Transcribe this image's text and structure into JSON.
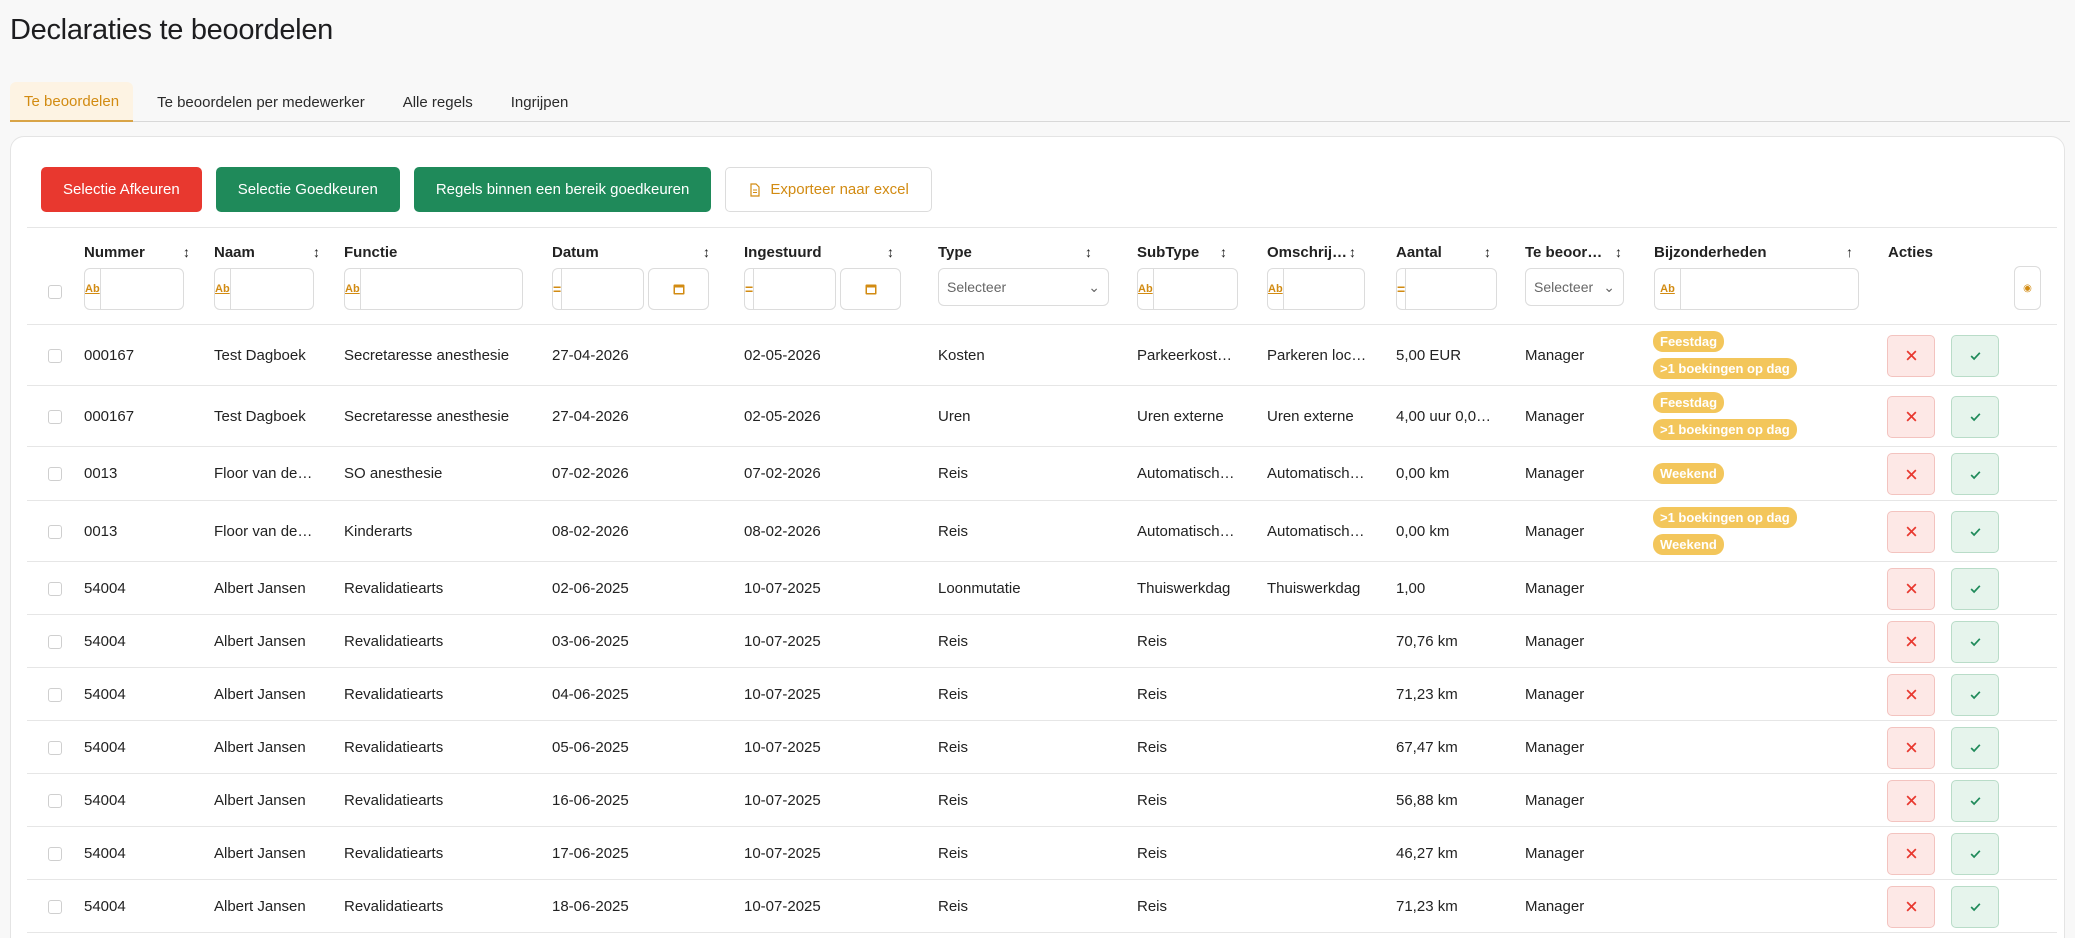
{
  "page": {
    "title": "Declaraties te beoordelen"
  },
  "tabs": [
    "Te beoordelen",
    "Te beoordelen per medewerker",
    "Alle regels",
    "Ingrijpen"
  ],
  "toolbar": {
    "reject_label": "Selectie Afkeuren",
    "approve_label": "Selectie Goedkeuren",
    "range_label": "Regels binnen een bereik goedkeuren",
    "export_label": "Exporteer naar excel"
  },
  "columns": {
    "nummer": "Nummer",
    "naam": "Naam",
    "functie": "Functie",
    "datum": "Datum",
    "ingestuurd": "Ingestuurd",
    "type": "Type",
    "subtype": "SubType",
    "omschrijving": "Omschrij…",
    "aantal": "Aantal",
    "te_beoordelen": "Te beoor…",
    "bijzonderheden": "Bijzonderheden",
    "acties": "Acties"
  },
  "filters": {
    "text_badge": "Ab",
    "eq_badge": "=",
    "select_placeholder": "Selecteer"
  },
  "rows": [
    {
      "nummer": "000167",
      "naam": "Test Dagboek",
      "functie": "Secretaresse anesthesie",
      "datum": "27-04-2026",
      "ingestuurd": "02-05-2026",
      "type": "Kosten",
      "subtype": "Parkeerkost…",
      "omschrijving": "Parkeren loc…",
      "aantal": "5,00 EUR",
      "te_beoordelen": "Manager",
      "bijzonderheden": [
        "Feestdag",
        ">1 boekingen op dag"
      ]
    },
    {
      "nummer": "000167",
      "naam": "Test Dagboek",
      "functie": "Secretaresse anesthesie",
      "datum": "27-04-2026",
      "ingestuurd": "02-05-2026",
      "type": "Uren",
      "subtype": "Uren externe",
      "omschrijving": "Uren externe",
      "aantal": "4,00 uur 0,0…",
      "te_beoordelen": "Manager",
      "bijzonderheden": [
        "Feestdag",
        ">1 boekingen op dag"
      ]
    },
    {
      "nummer": "0013",
      "naam": "Floor van de…",
      "functie": "SO anesthesie",
      "datum": "07-02-2026",
      "ingestuurd": "07-02-2026",
      "type": "Reis",
      "subtype": "Automatisch…",
      "omschrijving": "Automatisch…",
      "aantal": "0,00 km",
      "te_beoordelen": "Manager",
      "bijzonderheden": [
        "Weekend"
      ]
    },
    {
      "nummer": "0013",
      "naam": "Floor van de…",
      "functie": "Kinderarts",
      "datum": "08-02-2026",
      "ingestuurd": "08-02-2026",
      "type": "Reis",
      "subtype": "Automatisch…",
      "omschrijving": "Automatisch…",
      "aantal": "0,00 km",
      "te_beoordelen": "Manager",
      "bijzonderheden": [
        ">1 boekingen op dag",
        "Weekend"
      ]
    },
    {
      "nummer": "54004",
      "naam": "Albert Jansen",
      "functie": "Revalidatiearts",
      "datum": "02-06-2025",
      "ingestuurd": "10-07-2025",
      "type": "Loonmutatie",
      "subtype": "Thuiswerkdag",
      "omschrijving": "Thuiswerkdag",
      "aantal": "1,00",
      "te_beoordelen": "Manager",
      "bijzonderheden": []
    },
    {
      "nummer": "54004",
      "naam": "Albert Jansen",
      "functie": "Revalidatiearts",
      "datum": "03-06-2025",
      "ingestuurd": "10-07-2025",
      "type": "Reis",
      "subtype": "Reis",
      "omschrijving": "",
      "aantal": "70,76 km",
      "te_beoordelen": "Manager",
      "bijzonderheden": []
    },
    {
      "nummer": "54004",
      "naam": "Albert Jansen",
      "functie": "Revalidatiearts",
      "datum": "04-06-2025",
      "ingestuurd": "10-07-2025",
      "type": "Reis",
      "subtype": "Reis",
      "omschrijving": "",
      "aantal": "71,23 km",
      "te_beoordelen": "Manager",
      "bijzonderheden": []
    },
    {
      "nummer": "54004",
      "naam": "Albert Jansen",
      "functie": "Revalidatiearts",
      "datum": "05-06-2025",
      "ingestuurd": "10-07-2025",
      "type": "Reis",
      "subtype": "Reis",
      "omschrijving": "",
      "aantal": "67,47 km",
      "te_beoordelen": "Manager",
      "bijzonderheden": []
    },
    {
      "nummer": "54004",
      "naam": "Albert Jansen",
      "functie": "Revalidatiearts",
      "datum": "16-06-2025",
      "ingestuurd": "10-07-2025",
      "type": "Reis",
      "subtype": "Reis",
      "omschrijving": "",
      "aantal": "56,88 km",
      "te_beoordelen": "Manager",
      "bijzonderheden": []
    },
    {
      "nummer": "54004",
      "naam": "Albert Jansen",
      "functie": "Revalidatiearts",
      "datum": "17-06-2025",
      "ingestuurd": "10-07-2025",
      "type": "Reis",
      "subtype": "Reis",
      "omschrijving": "",
      "aantal": "46,27 km",
      "te_beoordelen": "Manager",
      "bijzonderheden": []
    },
    {
      "nummer": "54004",
      "naam": "Albert Jansen",
      "functie": "Revalidatiearts",
      "datum": "18-06-2025",
      "ingestuurd": "10-07-2025",
      "type": "Reis",
      "subtype": "Reis",
      "omschrijving": "",
      "aantal": "71,23 km",
      "te_beoordelen": "Manager",
      "bijzonderheden": []
    }
  ],
  "colors": {
    "accent": "#d28b12",
    "reject": "#e8382f",
    "approve": "#1f8a5a",
    "pill": "#f3c65b"
  }
}
